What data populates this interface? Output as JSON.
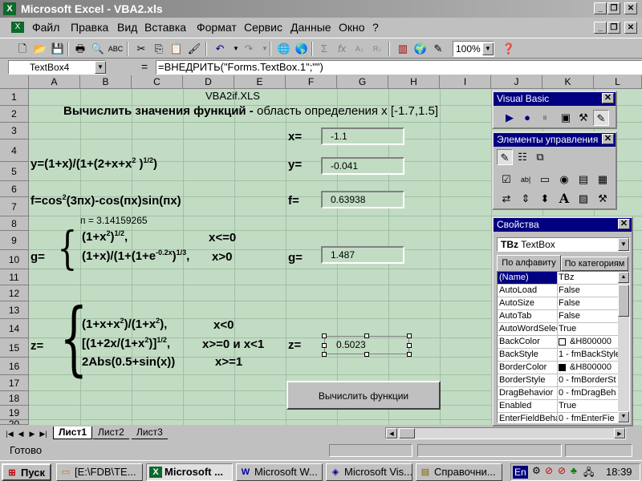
{
  "window": {
    "app_icon": "excel-icon",
    "title": "Microsoft Excel - VBA2.xls",
    "minimize": "_",
    "restore": "❐",
    "close": "✕",
    "doc_minimize": "_",
    "doc_restore": "❐",
    "doc_close": "✕"
  },
  "menu": [
    "Файл",
    "Правка",
    "Вид",
    "Вставка",
    "Формат",
    "Сервис",
    "Данные",
    "Окно",
    "?"
  ],
  "toolbar": {
    "zoom": "100%"
  },
  "formula_bar": {
    "name_box": "TextBox4",
    "equals": "=",
    "formula": "=ВНЕДРИТЬ(\"Forms.TextBox.1\";\"\")"
  },
  "columns": [
    "A",
    "B",
    "C",
    "D",
    "E",
    "F",
    "G",
    "H",
    "I",
    "J",
    "K",
    "L"
  ],
  "rows": [
    "1",
    "2",
    "3",
    "4",
    "5",
    "6",
    "7",
    "8",
    "9",
    "10",
    "11",
    "12",
    "13",
    "14",
    "15",
    "16",
    "17",
    "18",
    "19",
    "20"
  ],
  "sheet": {
    "filename": "VBA2if.XLS",
    "heading_bold": "Вычислить значения функций -",
    "heading_rest": " область определения x [-1.7,1.5]",
    "x_label": "x=",
    "x_value": "-1.1",
    "y_formula_main": "y=(1+x)/(1+(2+x+x",
    "y_formula_sup": "2",
    "y_formula_mid": " )",
    "y_formula_sup2": "1/2",
    "y_formula_end": ")",
    "y_label": "y=",
    "y_value": "-0.041",
    "f_formula_a": "f=cos",
    "f_formula_sup": "2",
    "f_formula_b": "(3пx)-cos(пx)sin(пx)",
    "f_label": "f=",
    "f_value": "0.63938",
    "pi_line": "п = 3.14159265",
    "g_label_left": "g=",
    "g_case1_a": "(1+x",
    "g_case1_sup": "2",
    "g_case1_b": ")",
    "g_case1_sup2": "1/2",
    "g_case1_c": ",",
    "g_cond1": "x<=0",
    "g_case2_a": "(1+x)/(1+(1+e",
    "g_case2_sup": "-0.2x",
    "g_case2_b": ")",
    "g_case2_sup2": "1/3",
    "g_case2_c": ",",
    "g_cond2": "x>0",
    "g_label": "g=",
    "g_value": "1.487",
    "z_label_left": "z=",
    "z_case1_a": "(1+x+x",
    "z_case1_sup": "2",
    "z_case1_b": ")/(1+x",
    "z_case1_sup2": "2",
    "z_case1_c": "),",
    "z_cond1": "x<0",
    "z_case2_a": "[(1+2x/(1+x",
    "z_case2_sup": "2",
    "z_case2_b": ")]",
    "z_case2_sup2": "1/2",
    "z_case2_c": ",",
    "z_cond2": "x>=0 и x<1",
    "z_case3": "2Abs(0.5+sin(x))",
    "z_cond3": "x>=1",
    "z_label": "z=",
    "z_value": "0.5023",
    "compute_button": "Вычислить функции"
  },
  "sheet_tabs": [
    "Лист1",
    "Лист2",
    "Лист3"
  ],
  "status": "Готово",
  "vb_toolbar": {
    "title": "Visual Basic",
    "close": "✕"
  },
  "controls_toolbar": {
    "title": "Элементы управления",
    "close": "✕"
  },
  "properties": {
    "title": "Свойства",
    "close": "✕",
    "object_bold": "TBz",
    "object_type": "TextBox",
    "tab_alpha": "По алфавиту",
    "tab_cat": "По категориям",
    "rows": [
      {
        "name": "(Name)",
        "value": "TBz"
      },
      {
        "name": "AutoLoad",
        "value": "False"
      },
      {
        "name": "AutoSize",
        "value": "False"
      },
      {
        "name": "AutoTab",
        "value": "False"
      },
      {
        "name": "AutoWordSelect",
        "value": "True"
      },
      {
        "name": "BackColor",
        "value": "&H800000"
      },
      {
        "name": "BackStyle",
        "value": "1 - fmBackStyle"
      },
      {
        "name": "BorderColor",
        "value": "&H800000"
      },
      {
        "name": "BorderStyle",
        "value": "0 - fmBorderSt"
      },
      {
        "name": "DragBehavior",
        "value": "0 - fmDragBeh"
      },
      {
        "name": "Enabled",
        "value": "True"
      },
      {
        "name": "EnterFieldBehavior",
        "value": "0 - fmEnterFie"
      }
    ]
  },
  "taskbar": {
    "start": "Пуск",
    "items": [
      "[E:\\FDB\\TE...",
      "Microsoft ...",
      "Microsoft W...",
      "Microsoft Vis...",
      "Справочни..."
    ],
    "lang": "En",
    "clock": "18:39"
  }
}
